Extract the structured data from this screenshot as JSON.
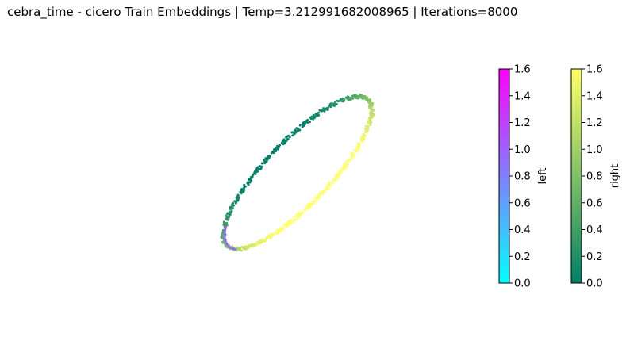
{
  "title": "cebra_time - cicero Train Embeddings | Temp=3.212991682008965 | Iterations=8000",
  "chart_data": {
    "type": "scatter",
    "title": "cebra_time - cicero Train Embeddings | Temp=3.212991682008965 | Iterations=8000",
    "axes_visible": false,
    "description_points": "2D projection of 3D embedding forming a tilted elliptical ring",
    "series": [
      {
        "name": "right",
        "colormap": "summer",
        "color_range": [
          "#008066",
          "#ffff66"
        ],
        "value_range": [
          0.0,
          1.6
        ]
      },
      {
        "name": "left",
        "colormap": "cool",
        "color_range": [
          "#00ffff",
          "#ff00ff"
        ],
        "value_range": [
          0.0,
          1.6
        ]
      }
    ],
    "colorbars": [
      {
        "label": "left",
        "colormap": "cool",
        "ticks": [
          "0.0",
          "0.2",
          "0.4",
          "0.6",
          "0.8",
          "1.0",
          "1.2",
          "1.4",
          "1.6"
        ],
        "range": [
          0.0,
          1.6
        ],
        "colors": [
          "#00ffff",
          "#ff00ff"
        ]
      },
      {
        "label": "right",
        "colormap": "summer",
        "ticks": [
          "0.0",
          "0.2",
          "0.4",
          "0.6",
          "0.8",
          "1.0",
          "1.2",
          "1.4",
          "1.6"
        ],
        "range": [
          0.0,
          1.6
        ],
        "colors": [
          "#008066",
          "#ffff66"
        ]
      }
    ]
  }
}
